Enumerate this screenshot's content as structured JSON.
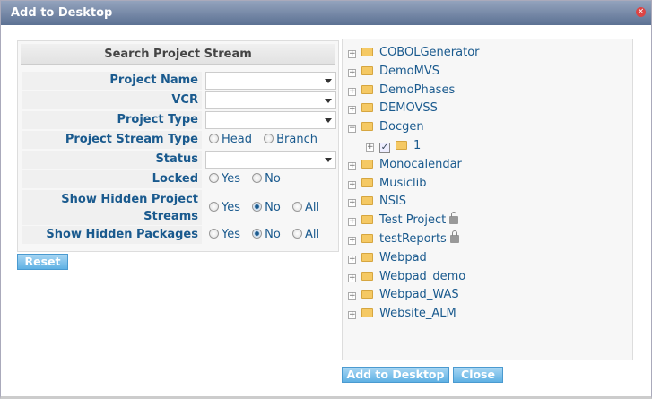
{
  "dialog": {
    "title": "Add to Desktop"
  },
  "search": {
    "header": "Search Project Stream",
    "project_name": {
      "label": "Project Name",
      "value": ""
    },
    "vcr": {
      "label": "VCR",
      "value": ""
    },
    "project_type": {
      "label": "Project Type",
      "value": ""
    },
    "stream_type": {
      "label": "Project Stream Type",
      "options": [
        "Head",
        "Branch"
      ],
      "selected": null
    },
    "status": {
      "label": "Status",
      "value": ""
    },
    "locked": {
      "label": "Locked",
      "options": [
        "Yes",
        "No"
      ],
      "selected": null
    },
    "hidden_streams": {
      "label_line1": "Show Hidden Project",
      "label_line2": "Streams",
      "options": [
        "Yes",
        "No",
        "All"
      ],
      "selected": "No"
    },
    "hidden_packages": {
      "label": "Show Hidden Packages",
      "options": [
        "Yes",
        "No",
        "All"
      ],
      "selected": "No"
    },
    "reset_label": "Reset"
  },
  "tree": {
    "items": [
      {
        "label": "COBOLGenerator"
      },
      {
        "label": "DemoMVS"
      },
      {
        "label": "DemoPhases"
      },
      {
        "label": "DEMOVSS"
      },
      {
        "label": "Docgen",
        "expanded": true
      },
      {
        "label": "1",
        "child": true,
        "checked": true
      },
      {
        "label": "Monocalendar"
      },
      {
        "label": "Musiclib"
      },
      {
        "label": "NSIS"
      },
      {
        "label": "Test Project",
        "locked": true
      },
      {
        "label": "testReports",
        "locked": true
      },
      {
        "label": "Webpad"
      },
      {
        "label": "Webpad_demo"
      },
      {
        "label": "Webpad_WAS"
      },
      {
        "label": "Website_ALM"
      }
    ]
  },
  "buttons": {
    "add": "Add to Desktop",
    "close": "Close"
  }
}
